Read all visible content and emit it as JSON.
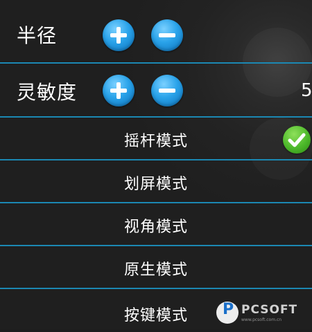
{
  "settings": {
    "radius": {
      "label": "半径"
    },
    "sensitivity": {
      "label": "灵敏度",
      "value": "5"
    }
  },
  "modes": [
    {
      "label": "摇杆模式",
      "selected": true
    },
    {
      "label": "划屏模式",
      "selected": false
    },
    {
      "label": "视角模式",
      "selected": false
    },
    {
      "label": "原生模式",
      "selected": false
    },
    {
      "label": "按键模式",
      "selected": false
    }
  ],
  "colors": {
    "divider": "#1b88b3",
    "button": "#2aa3ea",
    "check": "#4cb82a",
    "background": "#1e1e1e"
  },
  "watermark": {
    "logo_letter": "P",
    "text": "PCSOFT",
    "sub": "www.pcsoft.com.cn"
  }
}
